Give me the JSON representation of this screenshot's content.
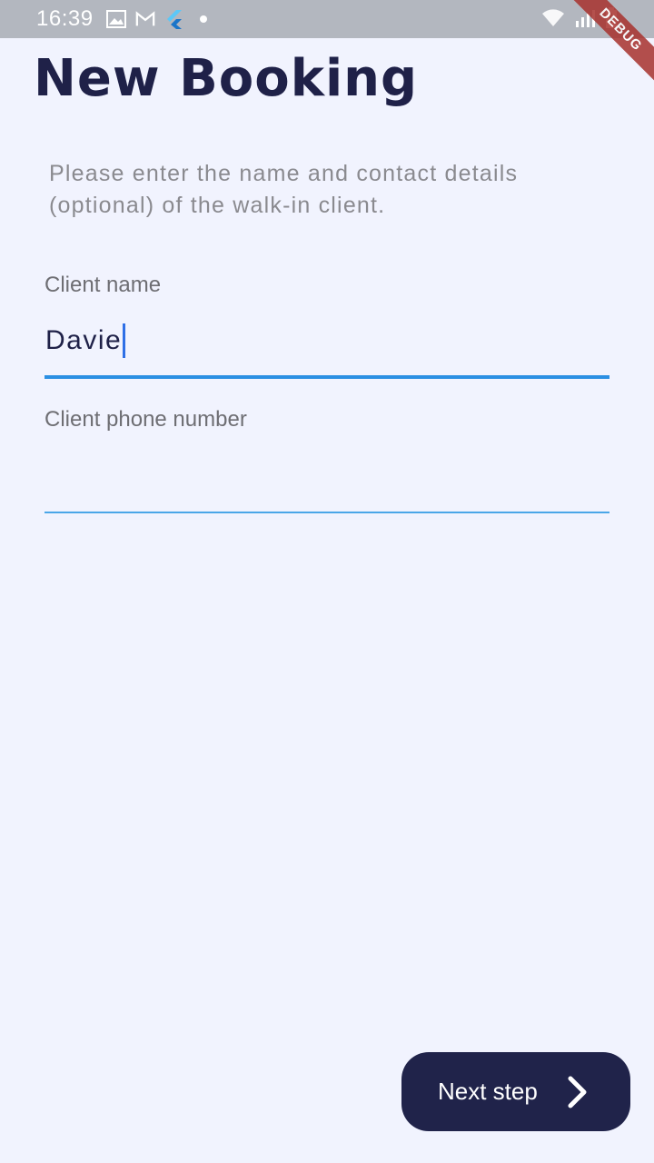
{
  "status_bar": {
    "time": "16:39",
    "icons_left": [
      "image-icon",
      "gmail-icon",
      "flutter-icon",
      "dot-icon"
    ],
    "icons_right": [
      "wifi-icon",
      "signal-icon",
      "battery-charging-icon"
    ]
  },
  "debug_banner": "DEBUG",
  "header": {
    "title": "New Booking"
  },
  "instructions": "Please enter the name and contact details (optional) of the walk-in client.",
  "form": {
    "name_label": "Client name",
    "name_value": "Davie",
    "phone_label": "Client phone number",
    "phone_value": ""
  },
  "actions": {
    "next_label": "Next step",
    "next_icon": "chevron-right-icon"
  },
  "colors": {
    "background": "#f1f3fe",
    "primary_dark": "#20234a",
    "accent_blue": "#2b8fe3",
    "status_bar": "#b3b7bf"
  }
}
